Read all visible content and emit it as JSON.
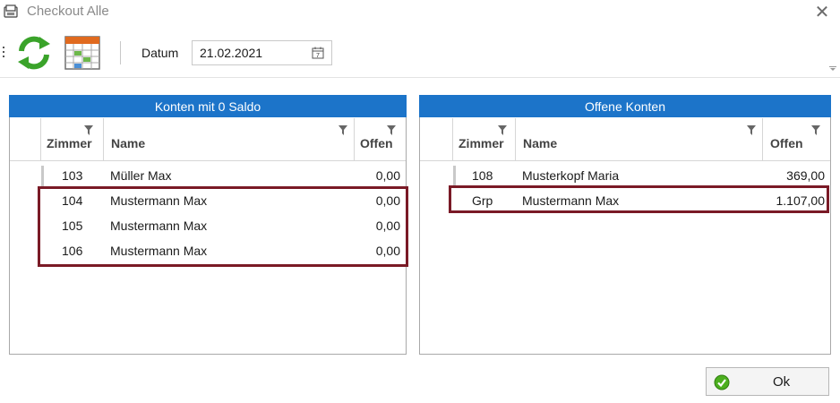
{
  "window": {
    "title": "Checkout Alle"
  },
  "toolbar": {
    "date_label": "Datum",
    "date_value": "21.02.2021"
  },
  "left_panel": {
    "title": "Konten mit 0 Saldo",
    "columns": [
      "Zimmer",
      "Name",
      "Offen"
    ],
    "rows": [
      {
        "zimmer": "103",
        "name": "Müller Max",
        "offen": "0,00"
      },
      {
        "zimmer": "104",
        "name": "Mustermann Max",
        "offen": "0,00"
      },
      {
        "zimmer": "105",
        "name": "Mustermann Max",
        "offen": "0,00"
      },
      {
        "zimmer": "106",
        "name": "Mustermann Max",
        "offen": "0,00"
      }
    ]
  },
  "right_panel": {
    "title": "Offene Konten",
    "columns": [
      "Zimmer",
      "Name",
      "Offen"
    ],
    "rows": [
      {
        "zimmer": "108",
        "name": "Musterkopf Maria",
        "offen": "369,00"
      },
      {
        "zimmer": "Grp",
        "name": "Mustermann Max",
        "offen": "1.107,00"
      }
    ]
  },
  "footer": {
    "ok_label": "Ok"
  },
  "colors": {
    "header_blue": "#1c74c9",
    "highlight": "#7a1a26",
    "refresh_green": "#3aa32a"
  },
  "icons": [
    "window-app-icon",
    "close-icon",
    "refresh-icon",
    "calendar-icon",
    "calendar-small-icon",
    "filter-icon",
    "ok-check-icon"
  ]
}
